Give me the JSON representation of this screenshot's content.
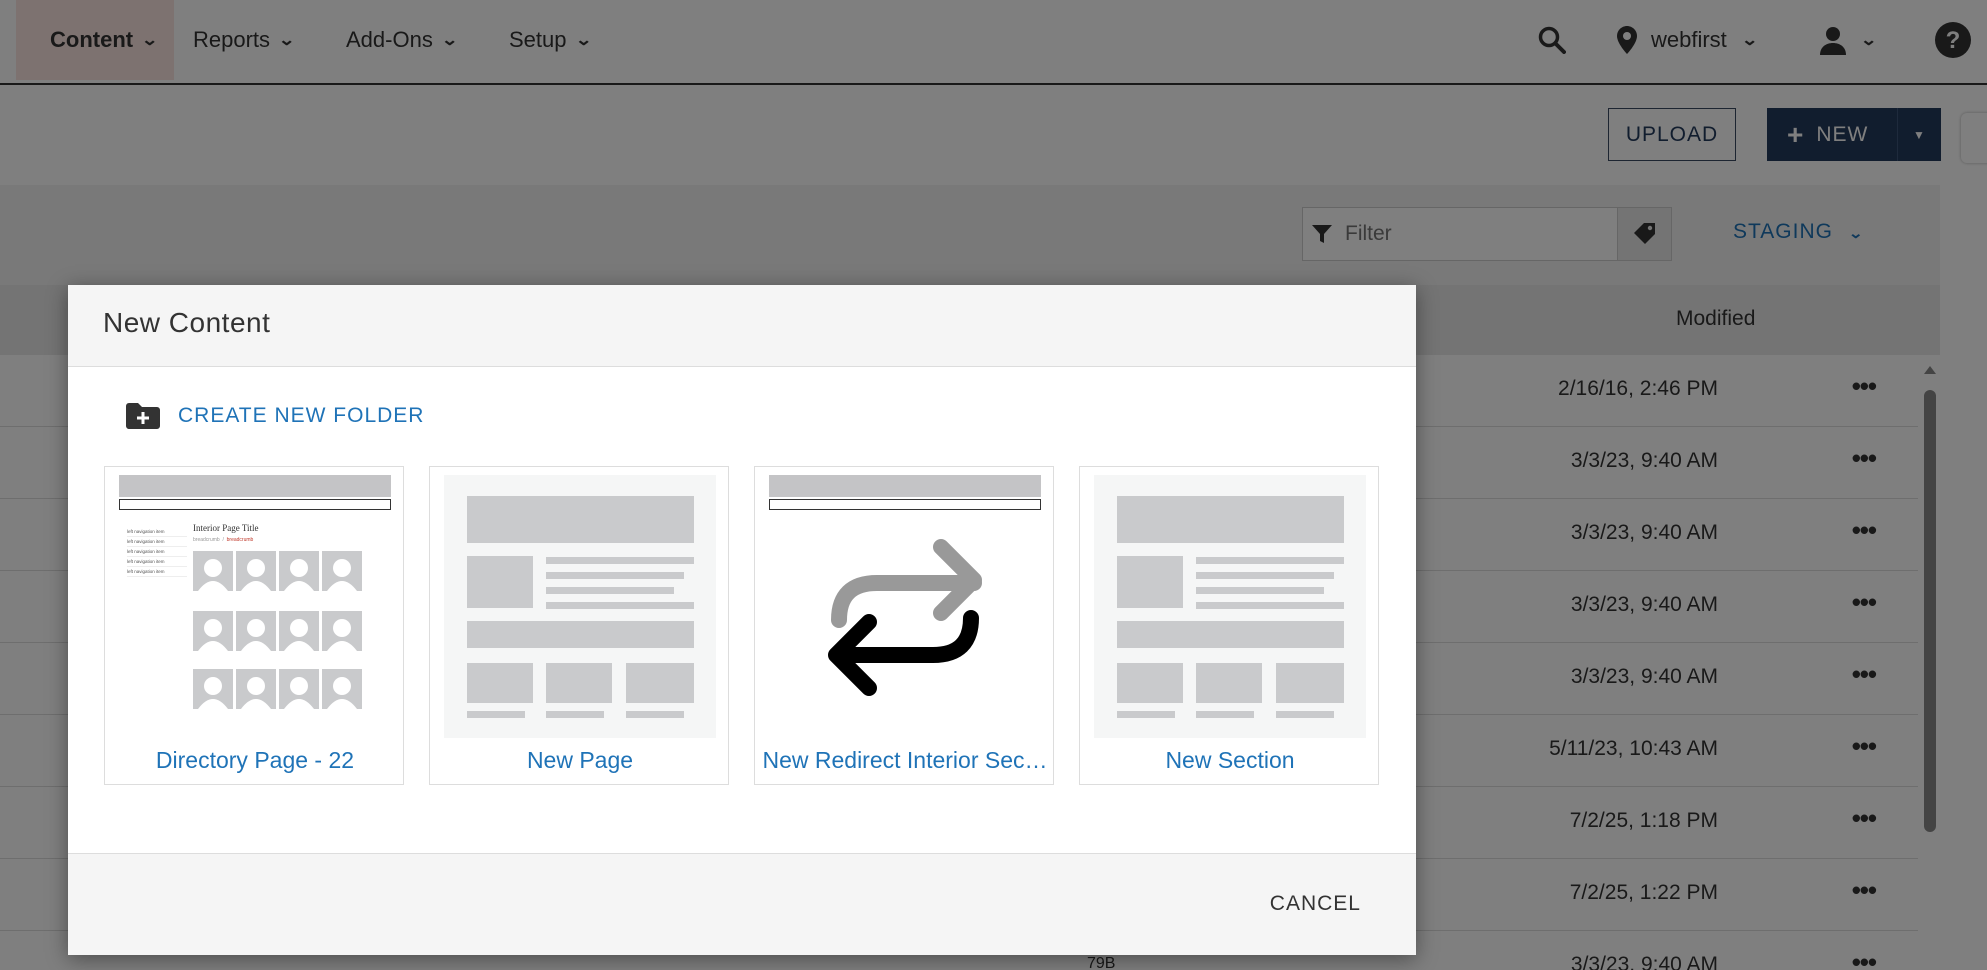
{
  "nav": {
    "items": [
      {
        "label": "Content"
      },
      {
        "label": "Reports"
      },
      {
        "label": "Add-Ons"
      },
      {
        "label": "Setup"
      }
    ],
    "site_name": "webfirst"
  },
  "toolbar": {
    "upload_label": "UPLOAD",
    "new_label": "NEW"
  },
  "filter": {
    "placeholder": "Filter",
    "environment": "STAGING"
  },
  "table": {
    "modified_header": "Modified",
    "rows": [
      {
        "modified": "2/16/16, 2:46 PM"
      },
      {
        "modified": "3/3/23, 9:40 AM"
      },
      {
        "modified": "3/3/23, 9:40 AM"
      },
      {
        "modified": "3/3/23, 9:40 AM"
      },
      {
        "modified": "3/3/23, 9:40 AM"
      },
      {
        "modified": "5/11/23, 10:43 AM"
      },
      {
        "modified": "7/2/25, 1:18 PM"
      },
      {
        "modified": "7/2/25, 1:22 PM"
      },
      {
        "modified": "3/3/23, 9:40 AM"
      }
    ],
    "partial_size": "79B",
    "more_glyph": "•••"
  },
  "modal": {
    "title": "New Content",
    "create_folder_label": "CREATE NEW FOLDER",
    "cards": [
      {
        "label": "Directory Page - 22",
        "type": "directory"
      },
      {
        "label": "New Page",
        "type": "page"
      },
      {
        "label": "New Redirect Interior Sec…",
        "type": "redirect"
      },
      {
        "label": "New Section",
        "type": "page"
      }
    ],
    "directory_thumb": {
      "page_title": "Interior Page Title",
      "breadcrumbs": [
        "breadcrumb",
        "breadcrumb"
      ],
      "nav_items": [
        "left navigation item",
        "left navigation item",
        "left navigation item",
        "left navigation item",
        "left navigation item"
      ]
    },
    "cancel_label": "CANCEL"
  },
  "colors": {
    "accent": "#1f73b7",
    "primary_button": "#233a5c",
    "nav_active": "#fbe5e1"
  }
}
